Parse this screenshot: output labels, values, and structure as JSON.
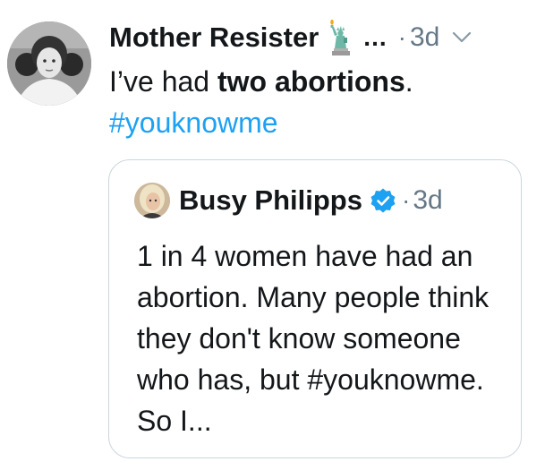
{
  "tweet": {
    "author_name": "Mother Resister",
    "ellipsis": "...",
    "separator": "·",
    "timestamp": "3d",
    "text_before": "I’ve had ",
    "text_bold": "two abortions",
    "text_after": ".",
    "hashtag": "#youknowme",
    "icons": {
      "author_emoji": "statue-of-liberty-icon",
      "menu": "chevron-down-icon"
    }
  },
  "quoted_tweet": {
    "author_name": "Busy Philipps",
    "separator": "·",
    "timestamp": "3d",
    "text": "1 in 4 women have had an abortion. Many people think they don't know someone who has, but #youknowme. So I...",
    "icons": {
      "verified": "verified-badge-icon"
    }
  },
  "colors": {
    "link": "#1da1f2",
    "secondary_text": "#657786",
    "border": "#ccd6dd",
    "verified": "#1da1f2"
  }
}
